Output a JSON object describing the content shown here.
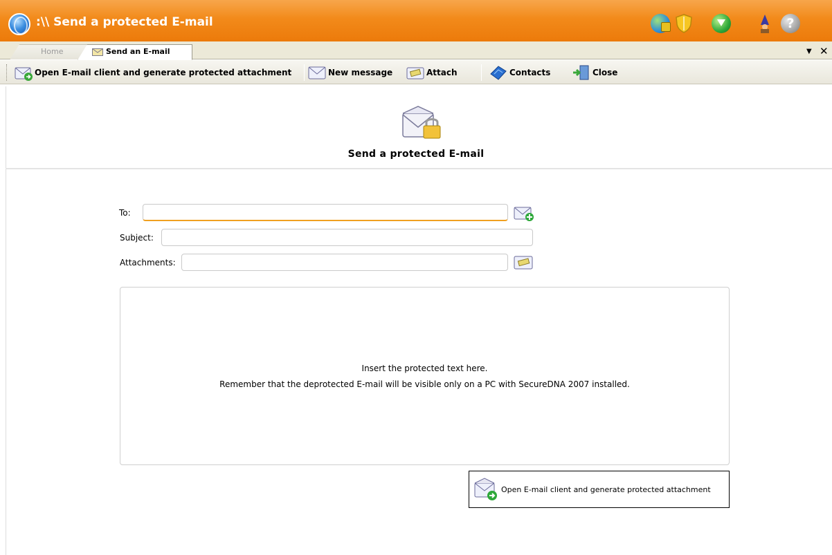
{
  "window": {
    "title": ":\\\\ Send a protected E-mail",
    "accent_color": "#f28a1a"
  },
  "title_icons": [
    "globe-lock-icon",
    "shield-icon",
    "download-icon",
    "wizard-icon",
    "help-icon"
  ],
  "tabs": [
    {
      "label": "Home",
      "active": false
    },
    {
      "label": "Send an E-mail",
      "active": true,
      "icon": "envelope-icon"
    }
  ],
  "toolbar": {
    "open_client_label": "Open E-mail client and generate protected attachment",
    "new_message_label": "New message",
    "attach_label": "Attach",
    "contacts_label": "Contacts",
    "close_label": "Close"
  },
  "header": {
    "title": "Send a protected E-mail"
  },
  "form": {
    "to_label": "To:",
    "to_value": "",
    "subject_label": "Subject:",
    "subject_value": "",
    "attachments_label": "Attachments:",
    "attachments_value": ""
  },
  "editor": {
    "line1": "Insert the protected text here.",
    "line2": "Remember that the deprotected E-mail will be visible only on a PC with SecureDNA 2007 installed."
  },
  "action_button": {
    "label": "Open E-mail client and generate protected attachment"
  }
}
